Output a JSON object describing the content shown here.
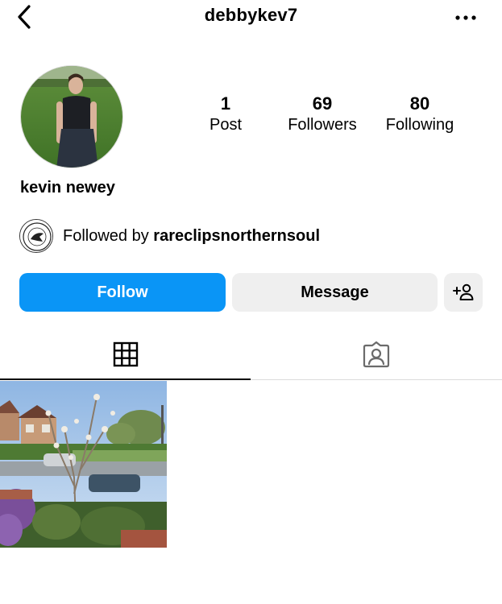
{
  "header": {
    "username": "debbykev7",
    "back_icon": "chevron-left-icon",
    "more_icon": "more-horizontal-icon"
  },
  "profile": {
    "display_name": "kevin newey",
    "stats": [
      {
        "value": "1",
        "label": "Post"
      },
      {
        "value": "69",
        "label": "Followers"
      },
      {
        "value": "80",
        "label": "Following"
      }
    ],
    "followed_by": {
      "prefix": "Followed by",
      "account": "rareclipsnorthernsoul"
    }
  },
  "actions": {
    "follow_label": "Follow",
    "message_label": "Message",
    "add_user_icon": "add-user-icon"
  },
  "tabs": [
    {
      "icon": "grid-icon",
      "active": true
    },
    {
      "icon": "tagged-icon",
      "active": false
    }
  ],
  "colors": {
    "follow_button": "#0a95f6",
    "secondary_button": "#efefef",
    "divider": "#dbdbdb"
  }
}
